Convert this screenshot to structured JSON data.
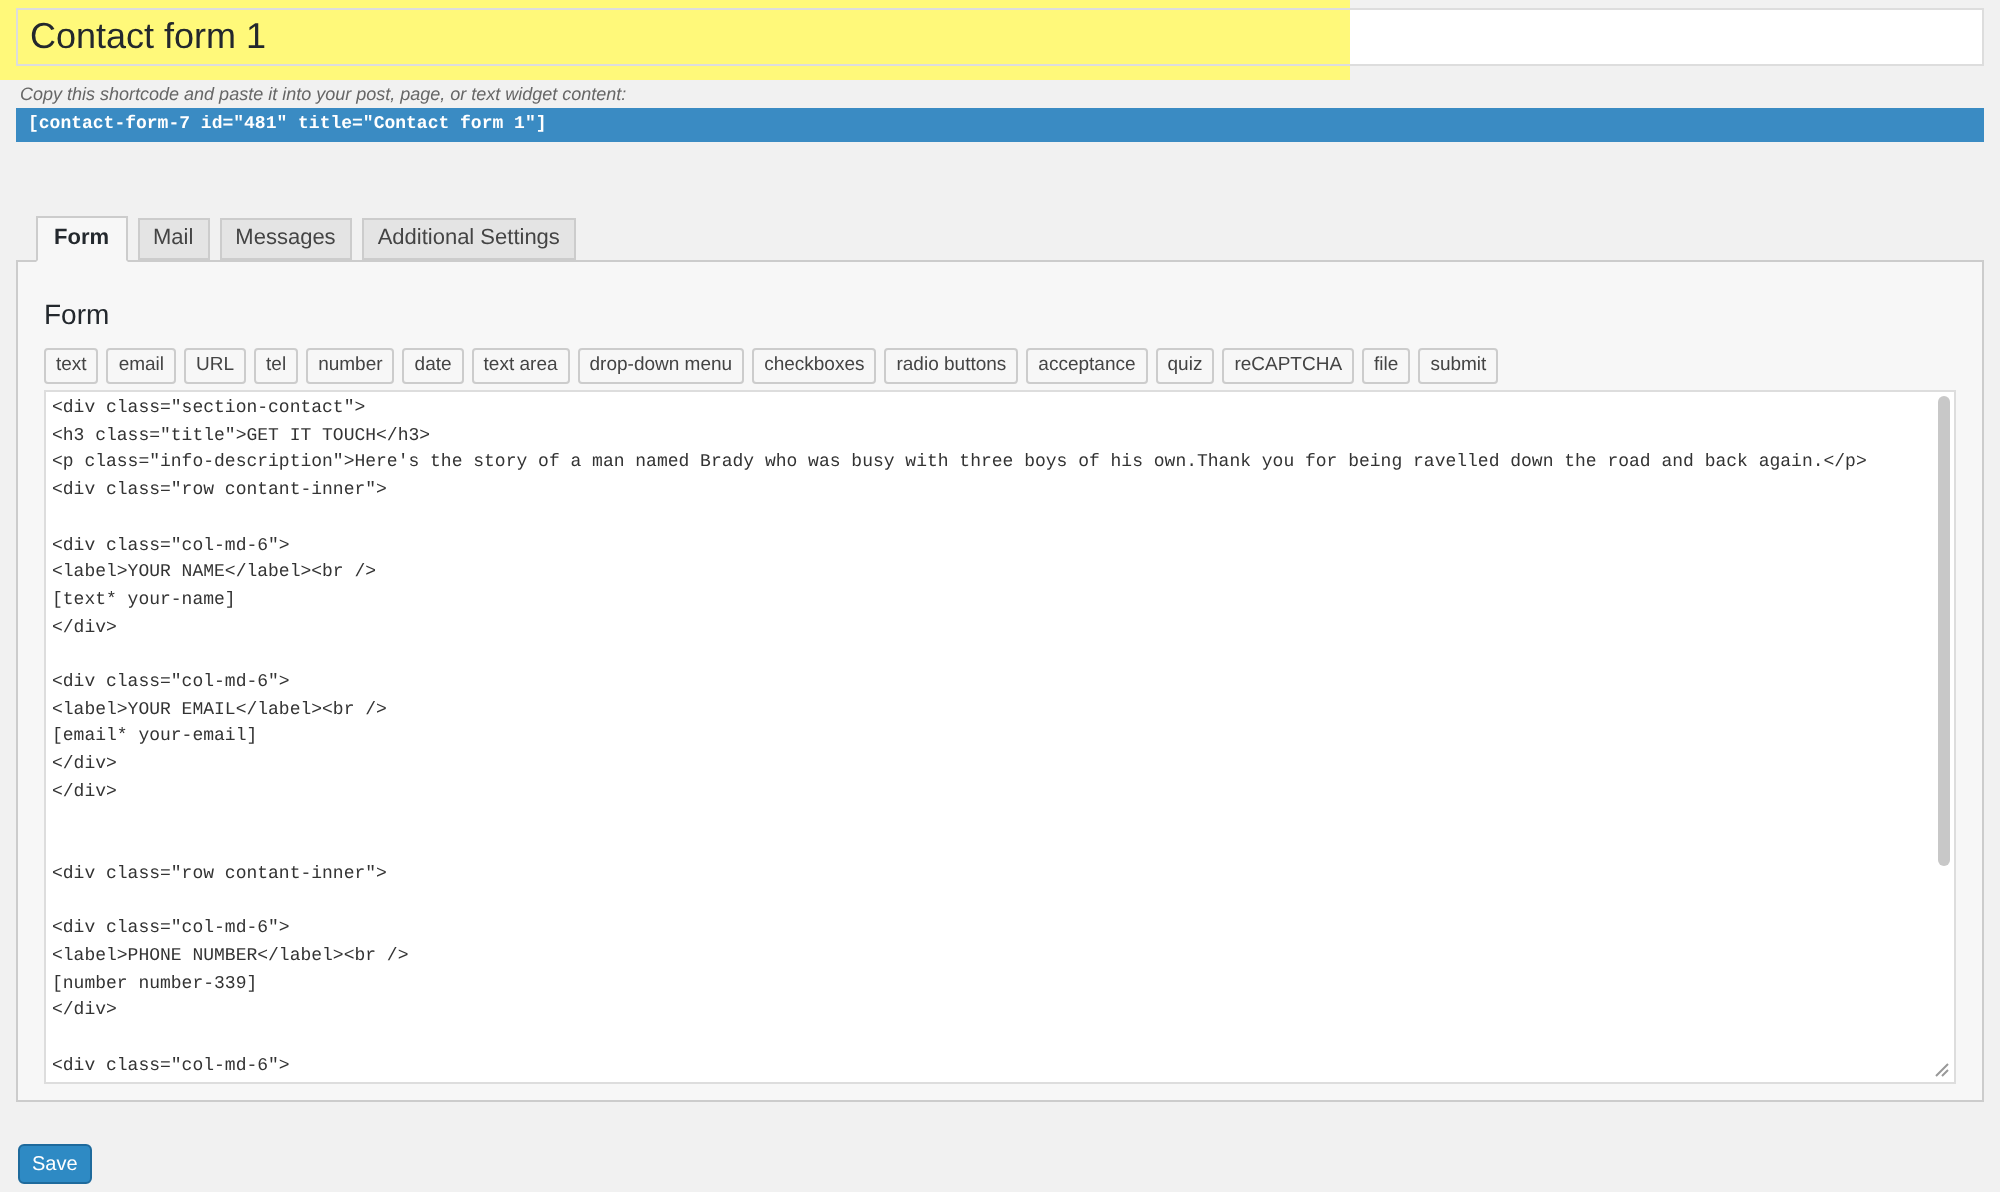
{
  "title_field": {
    "value": "Contact form 1",
    "highlighted": true
  },
  "shortcode_hint": "Copy this shortcode and paste it into your post, page, or text widget content:",
  "shortcode": "[contact-form-7 id=\"481\" title=\"Contact form 1\"]",
  "tabs": [
    {
      "label": "Form",
      "selected": true
    },
    {
      "label": "Mail",
      "selected": false
    },
    {
      "label": "Messages",
      "selected": false
    },
    {
      "label": "Additional Settings",
      "selected": false
    }
  ],
  "panel": {
    "heading": "Form",
    "tag_buttons": [
      "text",
      "email",
      "URL",
      "tel",
      "number",
      "date",
      "text area",
      "drop-down menu",
      "checkboxes",
      "radio buttons",
      "acceptance",
      "quiz",
      "reCAPTCHA",
      "file",
      "submit"
    ],
    "code": "<div class=\"section-contact\">\n<h3 class=\"title\">GET IT TOUCH</h3>\n<p class=\"info-description\">Here's the story of a man named Brady who was busy with three boys of his own.Thank you for being ravelled down the road and back again.</p>\n<div class=\"row contant-inner\">\n\n<div class=\"col-md-6\">\n<label>YOUR NAME</label><br />\n[text* your-name]\n</div>\n\n<div class=\"col-md-6\">\n<label>YOUR EMAIL</label><br />\n[email* your-email]\n</div>\n</div>\n\n\n<div class=\"row contant-inner\">\n\n<div class=\"col-md-6\">\n<label>PHONE NUMBER</label><br />\n[number number-339]\n</div>\n\n<div class=\"col-md-6\">"
  },
  "save_button": "Save"
}
